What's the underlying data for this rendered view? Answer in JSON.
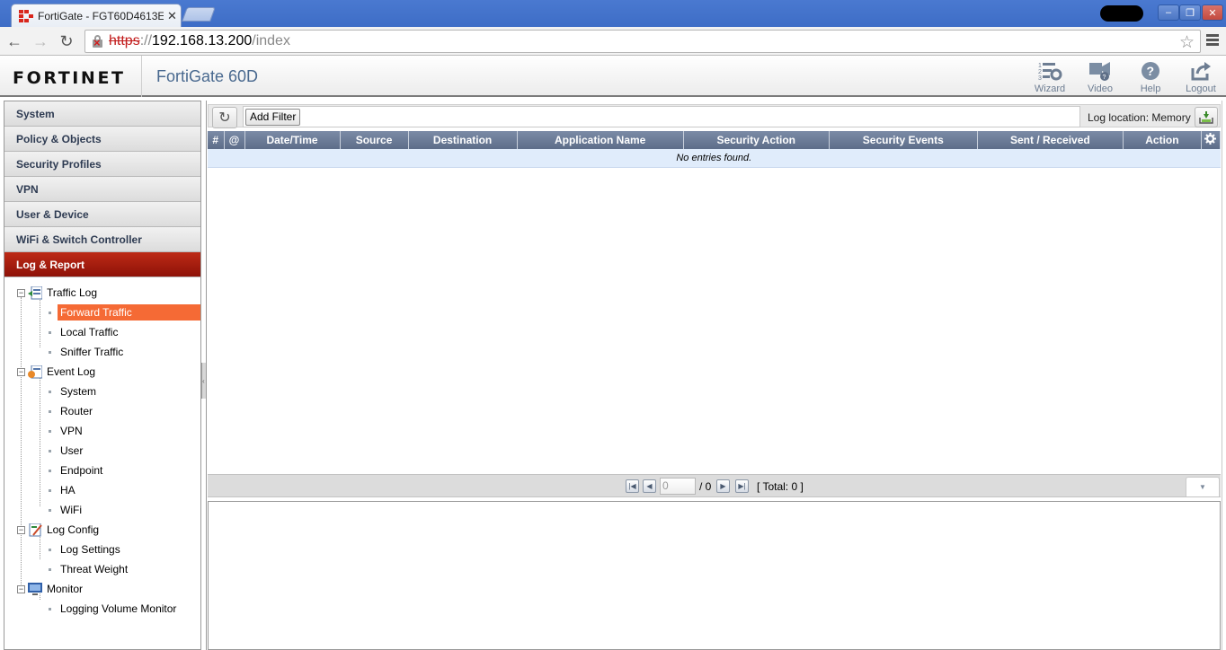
{
  "browser": {
    "tab_title": "FortiGate - FGT60D4613E",
    "url_scheme": "https",
    "url_sep": "://",
    "url_host": "192.168.13.200",
    "url_path": "/index",
    "window_buttons": [
      "–",
      "❐",
      "✕"
    ]
  },
  "header": {
    "logo": "FORTINET",
    "device": "FortiGate 60D",
    "buttons": [
      {
        "label": "Wizard",
        "icon": "wizard-icon"
      },
      {
        "label": "Video",
        "icon": "video-icon"
      },
      {
        "label": "Help",
        "icon": "help-icon"
      },
      {
        "label": "Logout",
        "icon": "logout-icon"
      }
    ]
  },
  "sidebar": {
    "sections": [
      "System",
      "Policy & Objects",
      "Security Profiles",
      "VPN",
      "User & Device",
      "WiFi & Switch Controller",
      "Log & Report"
    ],
    "active_section": "Log & Report",
    "tree": [
      {
        "label": "Traffic Log",
        "icon": "traffic-log-icon",
        "children": [
          "Forward Traffic",
          "Local Traffic",
          "Sniffer Traffic"
        ]
      },
      {
        "label": "Event Log",
        "icon": "event-log-icon",
        "children": [
          "System",
          "Router",
          "VPN",
          "User",
          "Endpoint",
          "HA",
          "WiFi"
        ]
      },
      {
        "label": "Log Config",
        "icon": "log-config-icon",
        "children": [
          "Log Settings",
          "Threat Weight"
        ]
      },
      {
        "label": "Monitor",
        "icon": "monitor-icon",
        "children": [
          "Logging Volume Monitor"
        ]
      }
    ],
    "selected_item": "Forward Traffic"
  },
  "main": {
    "add_filter_label": "Add Filter",
    "log_location": "Log location: Memory",
    "columns": [
      "#",
      "@",
      "Date/Time",
      "Source",
      "Destination",
      "Application Name",
      "Security Action",
      "Security Events",
      "Sent / Received",
      "Action"
    ],
    "empty_message": "No entries found.",
    "pager": {
      "page": "0",
      "of": "/ 0",
      "total": "[ Total: 0 ]"
    }
  },
  "colors": {
    "active_section": "#a81e0f",
    "selected_item": "#f56a35",
    "table_header": "#6b7b97",
    "empty_row": "#e0ecfb"
  }
}
